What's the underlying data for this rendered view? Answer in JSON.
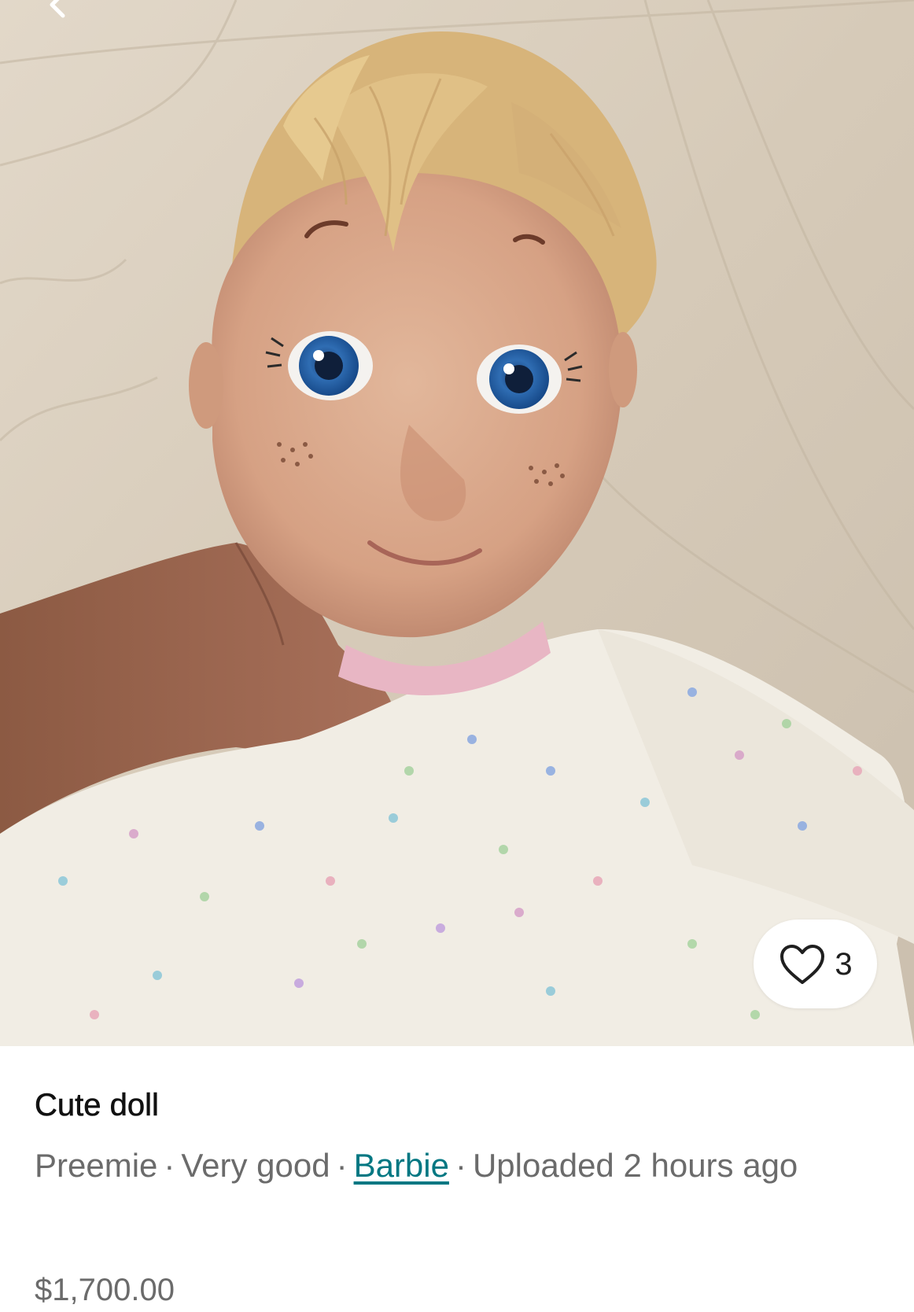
{
  "listing": {
    "image_alt": "Blonde baby doll with blue eyes and freckles wearing a white heart-print outfit, lying on a wooden floor",
    "likes": {
      "icon": "heart-outline-icon",
      "count": "3"
    },
    "title": "Cute doll",
    "meta": {
      "size": "Preemie",
      "separator": "·",
      "condition": "Very good",
      "brand": "Barbie",
      "uploaded": "Uploaded 2 hours ago"
    },
    "price": "$1,700.00"
  },
  "colors": {
    "brand_link": "#007782",
    "muted_text": "#6b6b6b",
    "title_text": "#111111"
  }
}
